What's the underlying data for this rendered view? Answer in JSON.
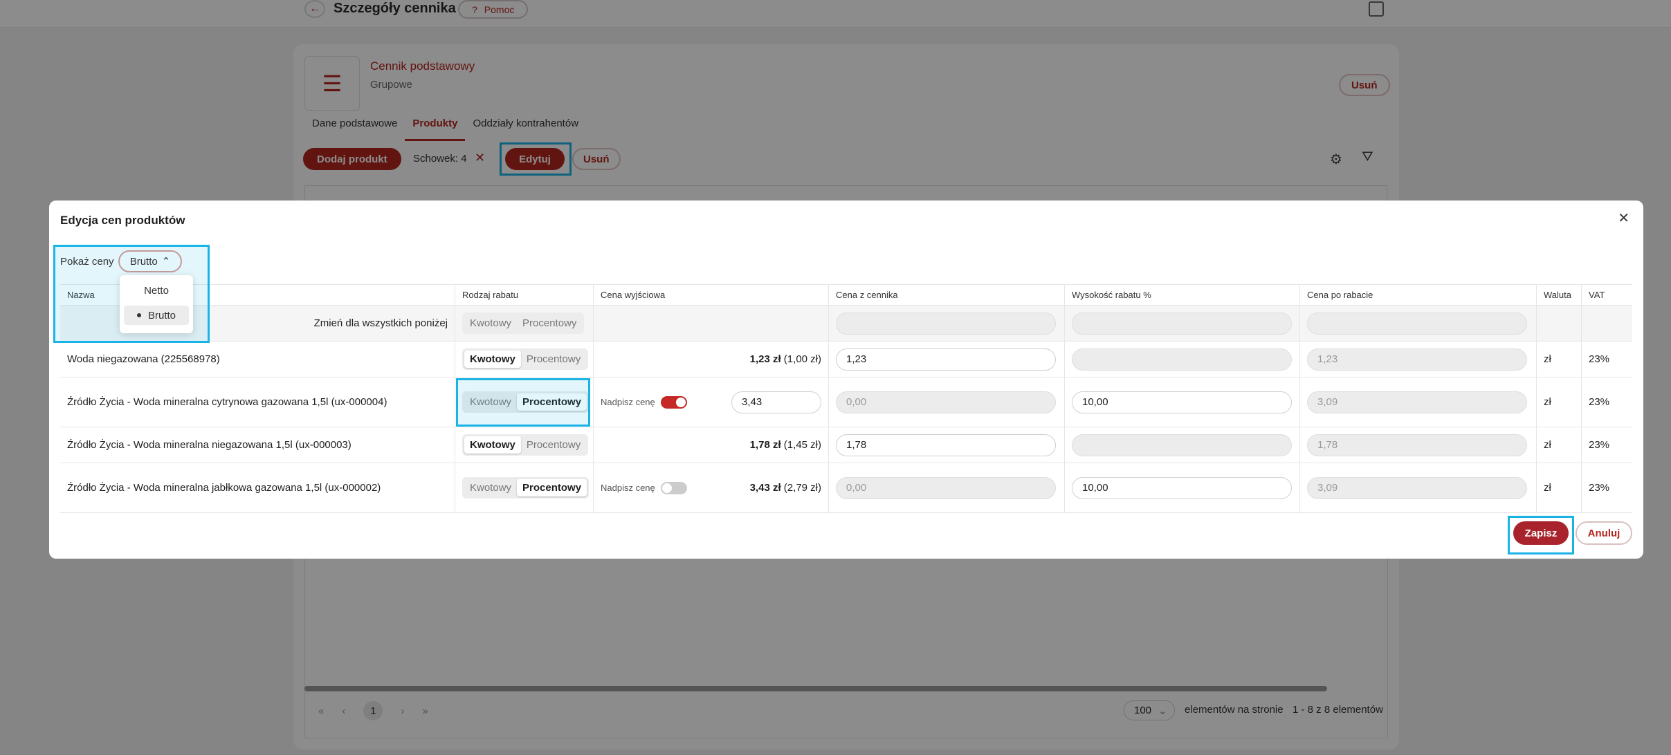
{
  "page": {
    "title": "Szczegóły cennika",
    "help_label": "Pomoc",
    "card_title": "Cennik podstawowy",
    "card_subtitle": "Grupowe",
    "card_delete": "Usuń",
    "tabs": [
      "Dane podstawowe",
      "Produkty",
      "Oddziały kontrahentów"
    ],
    "toolbar": {
      "add_label": "Dodaj produkt",
      "clipboard_label": "Schowek: 4",
      "edit_label": "Edytuj",
      "delete_label": "Usuń"
    },
    "pager": {
      "current": "1",
      "page_size": "100",
      "per_page_label": "elementów na stronie",
      "range_label": "1 - 8 z 8 elementów"
    }
  },
  "modal": {
    "title": "Edycja cen produktów",
    "show_prices_label": "Pokaż ceny",
    "show_prices_value": "Brutto",
    "options": [
      "Netto",
      "Brutto"
    ],
    "columns": [
      "Nazwa",
      "Rodzaj rabatu",
      "Cena wyjściowa",
      "Cena z cennika",
      "Wysokość rabatu %",
      "Cena po rabacie",
      "Waluta",
      "VAT"
    ],
    "bulk_label": "Zmień dla wszystkich poniżej",
    "seg_a": "Kwotowy",
    "seg_b": "Procentowy",
    "override_label": "Nadpisz cenę",
    "rows": [
      {
        "name": "Woda niegazowana (225568978)",
        "base_bold": "1,23 zł",
        "base_rest": " (1,00 zł)",
        "list_price": "1,23",
        "discount": "",
        "after": "1,23",
        "currency": "zł",
        "vat": "23%"
      },
      {
        "name": "Źródło Życia - Woda mineralna cytrynowa gazowana 1,5l (ux-000004)",
        "override_value": "3,43",
        "list_price": "0,00",
        "discount": "10,00",
        "after": "3,09",
        "currency": "zł",
        "vat": "23%"
      },
      {
        "name": "Źródło Życia - Woda mineralna niegazowana 1,5l (ux-000003)",
        "base_bold": "1,78 zł",
        "base_rest": " (1,45 zł)",
        "list_price": "1,78",
        "discount": "",
        "after": "1,78",
        "currency": "zł",
        "vat": "23%"
      },
      {
        "name": "Źródło Życia - Woda mineralna jabłkowa gazowana 1,5l (ux-000002)",
        "base_bold": "3,43 zł",
        "base_rest": " (2,79 zł)",
        "list_price": "0,00",
        "discount": "10,00",
        "after": "3,09",
        "currency": "zł",
        "vat": "23%"
      }
    ],
    "save_label": "Zapisz",
    "cancel_label": "Anuluj"
  }
}
